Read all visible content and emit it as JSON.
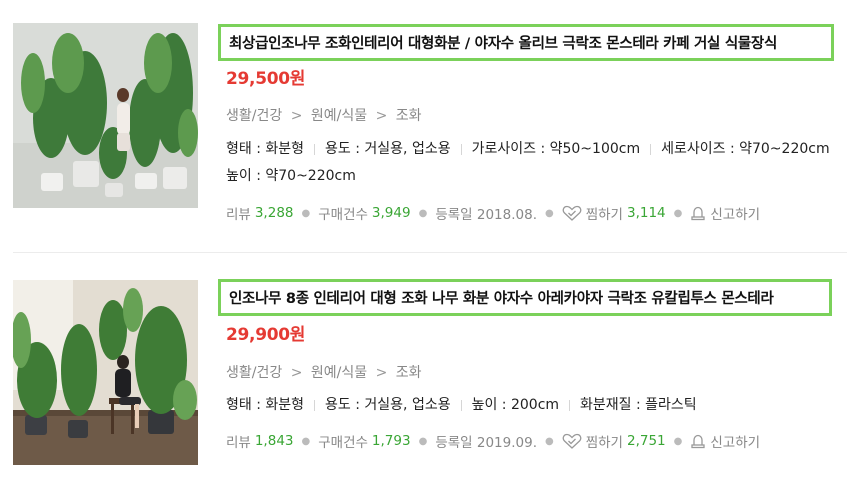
{
  "results": [
    {
      "title": "최상급인조나무 조화인테리어 대형화분 / 야자수 올리브 극락조 몬스테라 카페 거실 식물장식",
      "price": "29,500원",
      "category": [
        "생활/건강",
        "원예/식물",
        "조화"
      ],
      "category_sep": ">",
      "specs": [
        "형태 : 화분형",
        "용도 : 거실용, 업소용",
        "가로사이즈 : 약50~100cm",
        "세로사이즈 : 약70~220cm",
        "높이 : 약70~220cm"
      ],
      "review_label": "리뷰",
      "review_count": "3,288",
      "purchase_label": "구매건수",
      "purchase_count": "3,949",
      "registered": "등록일 2018.08.",
      "wish_label": "찜하기",
      "wish_count": "3,114",
      "report_label": "신고하기"
    },
    {
      "title": "인조나무 8종 인테리어 대형 조화 나무 화분 야자수 아레카야자 극락조 유칼립투스 몬스테라",
      "price": "29,900원",
      "category": [
        "생활/건강",
        "원예/식물",
        "조화"
      ],
      "category_sep": ">",
      "specs": [
        "형태 : 화분형",
        "용도 : 거실용, 업소용",
        "높이 : 200cm",
        "화분재질 : 플라스틱"
      ],
      "review_label": "리뷰",
      "review_count": "1,843",
      "purchase_label": "구매건수",
      "purchase_count": "1,793",
      "registered": "등록일 2019.09.",
      "wish_label": "찜하기",
      "wish_count": "2,751",
      "report_label": "신고하기"
    }
  ],
  "icons": {
    "wish": "heart-check-icon",
    "report": "siren-bell-icon"
  },
  "colors": {
    "price": "#e53a33",
    "count": "#3aa635",
    "highlight_border": "#7bd15a"
  }
}
